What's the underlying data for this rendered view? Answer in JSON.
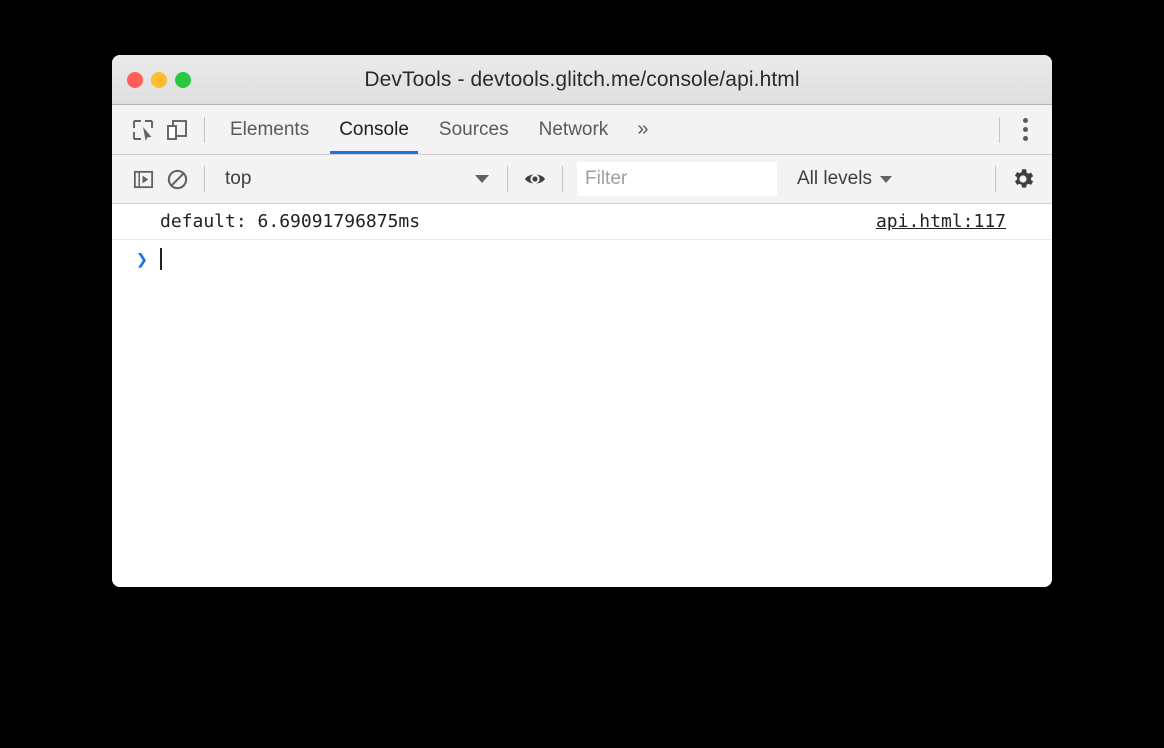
{
  "window": {
    "title": "DevTools - devtools.glitch.me/console/api.html",
    "traffic_lights": {
      "close_label": "close",
      "minimize_label": "minimize",
      "zoom_label": "zoom",
      "close_color": "#ff5f57",
      "minimize_color": "#febc2e",
      "zoom_color": "#28c840"
    }
  },
  "tabbar": {
    "inspect_icon": "inspect-element-icon",
    "device_icon": "device-toolbar-icon",
    "tabs": [
      {
        "label": "Elements",
        "active": false
      },
      {
        "label": "Console",
        "active": true
      },
      {
        "label": "Sources",
        "active": false
      },
      {
        "label": "Network",
        "active": false
      }
    ],
    "overflow_label": "»",
    "more_icon": "kebab-menu-icon",
    "active_underline_color": "#1a73e8"
  },
  "console_toolbar": {
    "sidebar_icon": "show-console-sidebar-icon",
    "clear_icon": "clear-console-icon",
    "context": {
      "value": "top"
    },
    "eye_icon": "live-expression-eye-icon",
    "filter": {
      "value": "",
      "placeholder": "Filter"
    },
    "levels": {
      "value": "All levels"
    },
    "settings_icon": "settings-gear-icon"
  },
  "console": {
    "messages": [
      {
        "text": "default: 6.69091796875ms",
        "source_link": "api.html:117"
      }
    ],
    "prompt": {
      "arrow": "❯",
      "input_value": ""
    }
  }
}
